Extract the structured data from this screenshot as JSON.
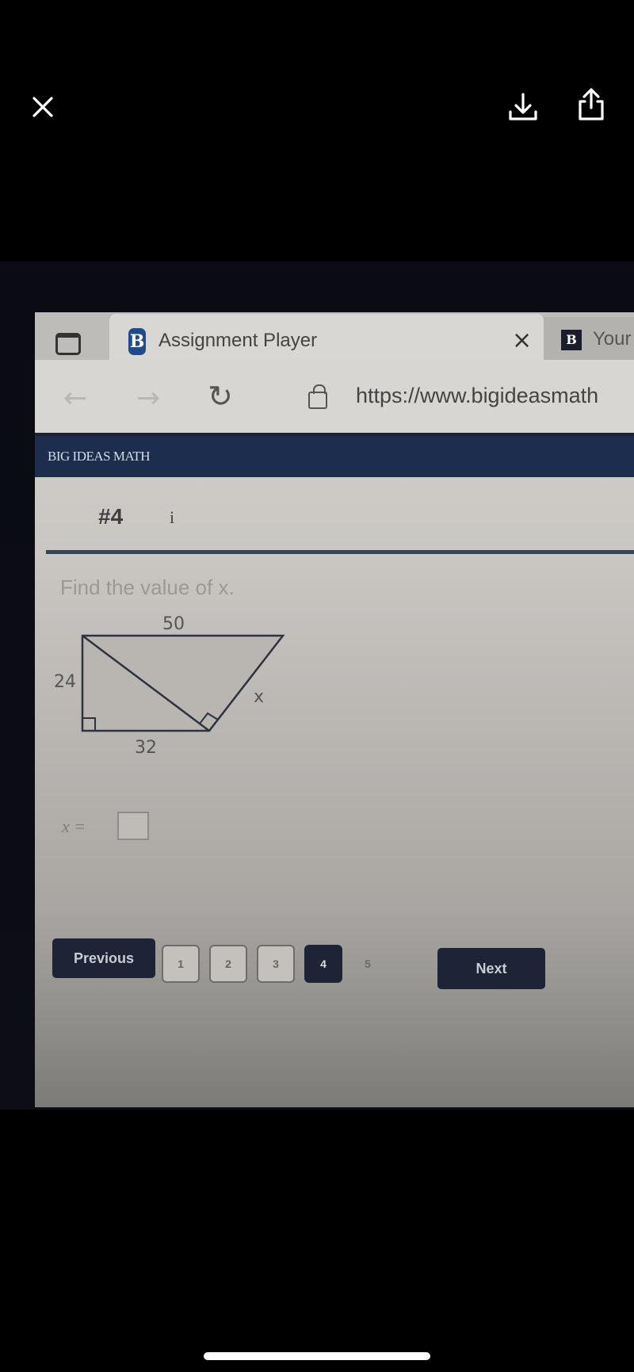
{
  "viewer": {
    "close_icon": "close-icon",
    "download_icon": "download-icon",
    "share_icon": "share-icon"
  },
  "browser": {
    "tabs": [
      {
        "label": "Assignment Player",
        "favicon": "B",
        "active": true
      },
      {
        "label": "Your f",
        "favicon": "B",
        "active": false
      }
    ],
    "tab_close": "×",
    "back_glyph": "←",
    "forward_glyph": "→",
    "reload_glyph": "↻",
    "url": "https://www.bigideasmath"
  },
  "site": {
    "brand": "BIG IDEAS MATH"
  },
  "question": {
    "number": "#4",
    "info_glyph": "i",
    "prompt": "Find the value of x.",
    "diagram": {
      "top_label": "50",
      "left_label": "24",
      "bottom_label": "32",
      "slant_label": "x"
    },
    "answer_label": "x =",
    "answer_value": ""
  },
  "pager": {
    "previous_label": "Previous",
    "next_label": "Next",
    "pages": [
      "1",
      "2",
      "3",
      "4",
      "5"
    ],
    "current_page": "4"
  },
  "colors": {
    "header_navy": "#1d2d4e",
    "button_dark": "#1c2436",
    "favicon_blue": "#1f4b8e"
  }
}
